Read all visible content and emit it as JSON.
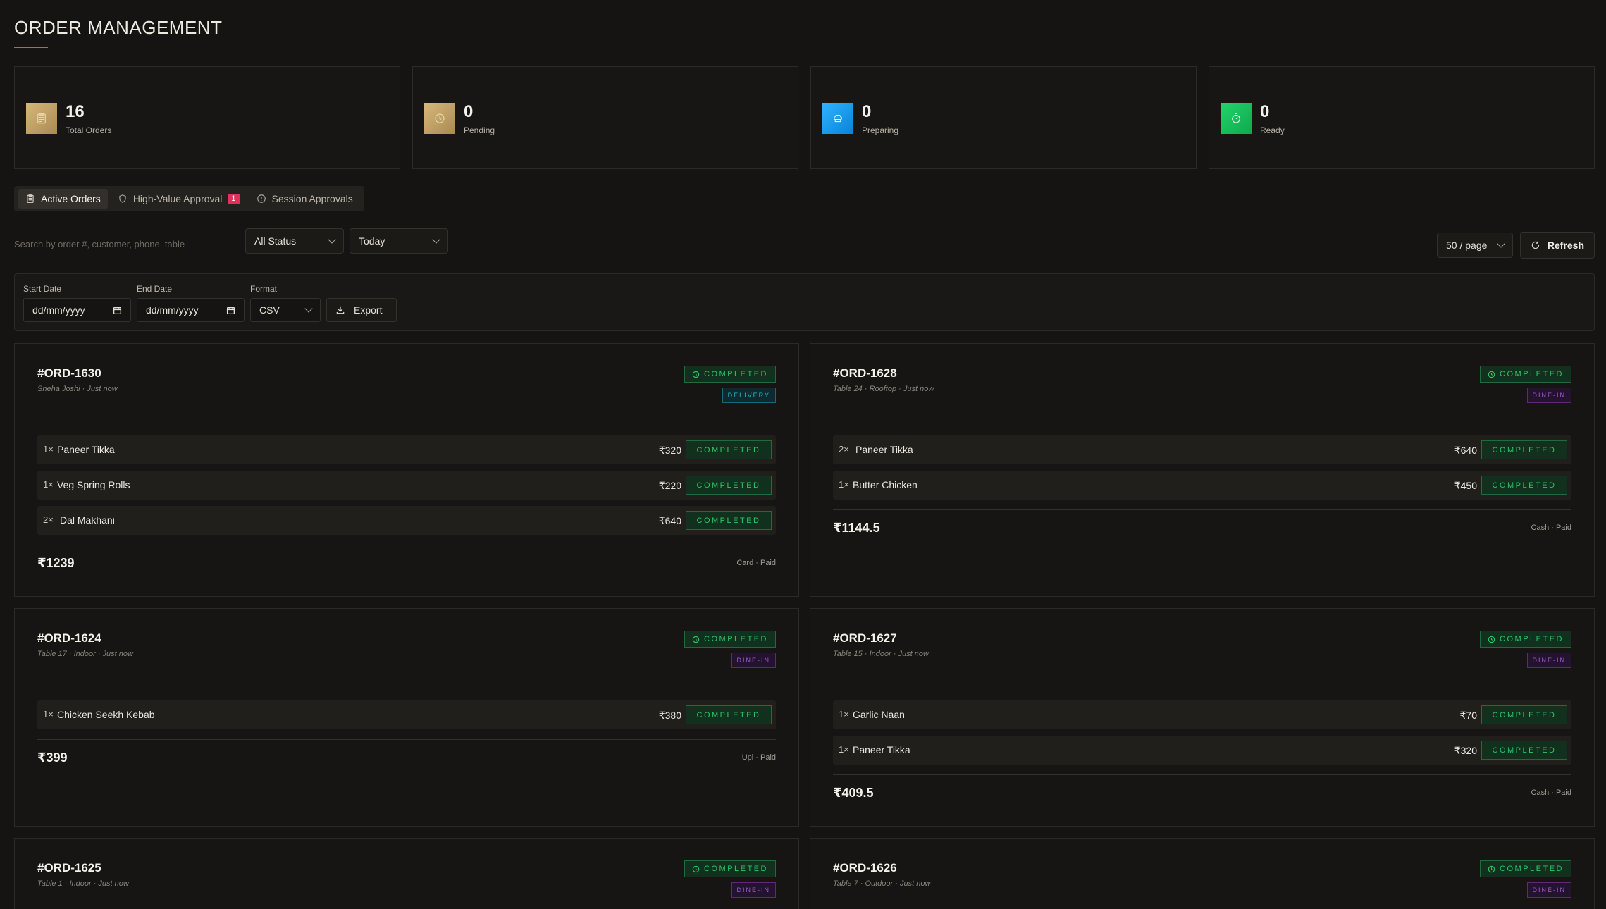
{
  "header": {
    "title": "ORDER MANAGEMENT"
  },
  "stats": [
    {
      "value": "16",
      "label": "Total Orders",
      "icon": "clipboard-icon",
      "color": "#c4a36a"
    },
    {
      "value": "0",
      "label": "Pending",
      "icon": "clock-icon",
      "color": "#c4a36a"
    },
    {
      "value": "0",
      "label": "Preparing",
      "icon": "chef-hat-icon",
      "color": "#1aa0f0"
    },
    {
      "value": "0",
      "label": "Ready",
      "icon": "timer-icon",
      "color": "#17c45e"
    }
  ],
  "tabs": [
    {
      "label": "Active Orders",
      "icon": "clipboard-icon",
      "active": true
    },
    {
      "label": "High-Value Approval",
      "icon": "shield-icon",
      "badge": "1"
    },
    {
      "label": "Session Approvals",
      "icon": "alert-circle-icon"
    }
  ],
  "filters": {
    "search_placeholder": "Search by order #, customer, phone, table",
    "status": "All Status",
    "period": "Today",
    "page_size": "50 / page",
    "refresh_label": "Refresh"
  },
  "export": {
    "start_label": "Start Date",
    "start_value": "dd/mm/yyyy",
    "end_label": "End Date",
    "end_value": "dd/mm/yyyy",
    "format_label": "Format",
    "format_value": "CSV",
    "export_label": "Export"
  },
  "orders": [
    {
      "id": "#ORD-1630",
      "meta": "Sneha Joshi · Just now",
      "status": "COMPLETED",
      "type": "DELIVERY",
      "items": [
        {
          "qty": "1×",
          "name": "Paneer Tikka",
          "price": "₹320",
          "status": "COMPLETED"
        },
        {
          "qty": "1×",
          "name": "Veg Spring Rolls",
          "price": "₹220",
          "status": "COMPLETED"
        },
        {
          "qty": "2×",
          "name": "Dal Makhani",
          "price": "₹640",
          "status": "COMPLETED"
        }
      ],
      "total": "₹1239",
      "payment": "Card · Paid"
    },
    {
      "id": "#ORD-1628",
      "meta": "Table 24 · Rooftop · Just now",
      "status": "COMPLETED",
      "type": "DINE-IN",
      "items": [
        {
          "qty": "2×",
          "name": "Paneer Tikka",
          "price": "₹640",
          "status": "COMPLETED"
        },
        {
          "qty": "1×",
          "name": "Butter Chicken",
          "price": "₹450",
          "status": "COMPLETED"
        }
      ],
      "total": "₹1144.5",
      "payment": "Cash · Paid"
    },
    {
      "id": "#ORD-1624",
      "meta": "Table 17 · Indoor · Just now",
      "status": "COMPLETED",
      "type": "DINE-IN",
      "items": [
        {
          "qty": "1×",
          "name": "Chicken Seekh Kebab",
          "price": "₹380",
          "status": "COMPLETED"
        }
      ],
      "total": "₹399",
      "payment": "Upi · Paid"
    },
    {
      "id": "#ORD-1627",
      "meta": "Table 15 · Indoor · Just now",
      "status": "COMPLETED",
      "type": "DINE-IN",
      "items": [
        {
          "qty": "1×",
          "name": "Garlic Naan",
          "price": "₹70",
          "status": "COMPLETED"
        },
        {
          "qty": "1×",
          "name": "Paneer Tikka",
          "price": "₹320",
          "status": "COMPLETED"
        }
      ],
      "total": "₹409.5",
      "payment": "Cash · Paid"
    },
    {
      "id": "#ORD-1625",
      "meta": "Table 1 · Indoor · Just now",
      "status": "COMPLETED",
      "type": "DINE-IN",
      "items": [],
      "total": "",
      "payment": ""
    },
    {
      "id": "#ORD-1626",
      "meta": "Table 7 · Outdoor · Just now",
      "status": "COMPLETED",
      "type": "DINE-IN",
      "items": [],
      "total": "",
      "payment": ""
    }
  ]
}
